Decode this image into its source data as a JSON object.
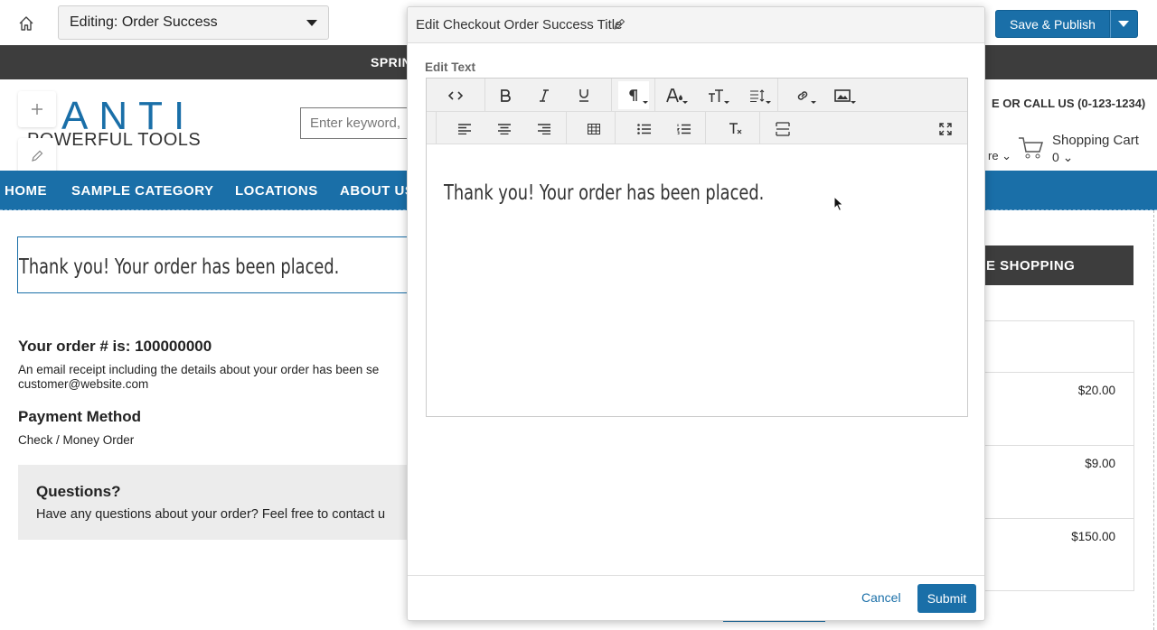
{
  "editor_bar": {
    "page_select_value": "Editing: Order Success",
    "publish_label": "Save & Publish"
  },
  "store": {
    "promo_text": "SPRIN",
    "logo_brand": "ANTI",
    "logo_tagline": "POWERFUL TOOLS",
    "search_placeholder": "Enter keyword,",
    "call_us": "E OR CALL US (0-123-1234)",
    "more_label": "re",
    "cart_label": "Shopping Cart",
    "cart_count": "0",
    "nav": [
      "HOME",
      "SAMPLE CATEGORY",
      "LOCATIONS",
      "ABOUT US"
    ],
    "page_title": "Thank you! Your order has been placed.",
    "order_number": "Your order # is: 100000000",
    "receipt_line1": "An email receipt including the details about your order has been se",
    "receipt_line2": "customer@website.com",
    "payment_heading": "Payment Method",
    "payment_value": "Check / Money Order",
    "questions_heading": "Questions?",
    "questions_text": "Have any questions about your order? Feel free to contact u",
    "continue_label": "E SHOPPING",
    "prices": [
      "$20.00",
      "$9.00",
      "$150.00"
    ]
  },
  "modal": {
    "title": "Edit Checkout Order Success Title",
    "edit_text_label": "Edit Text",
    "content": "Thank you! Your order has been placed.",
    "cancel_label": "Cancel",
    "submit_label": "Submit"
  },
  "colors": {
    "accent": "#1a6fa8",
    "dark_bar": "#3d3d3d"
  },
  "icons": {
    "toolbar_row1": [
      "code-view-icon",
      "bold-icon",
      "italic-icon",
      "underline-icon",
      "paragraph-format-icon",
      "text-color-icon",
      "font-size-icon",
      "line-height-icon",
      "insert-link-icon",
      "insert-image-icon"
    ],
    "toolbar_row2": [
      "align-left-icon",
      "align-center-icon",
      "align-right-icon",
      "insert-table-icon",
      "unordered-list-icon",
      "ordered-list-icon",
      "clear-formatting-icon",
      "insert-hr-icon",
      "fullscreen-icon"
    ]
  }
}
